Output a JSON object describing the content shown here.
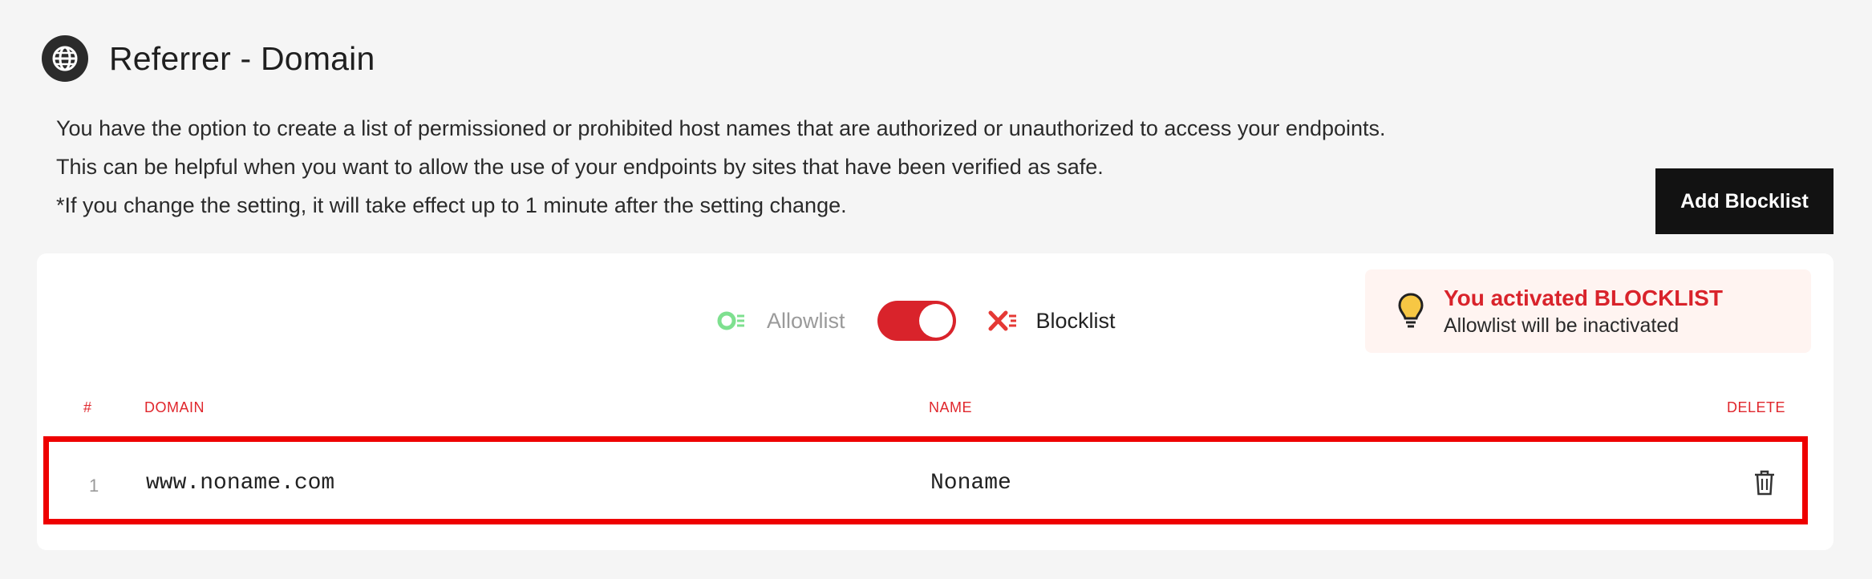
{
  "header": {
    "icon": "globe-icon",
    "title": "Referrer - Domain"
  },
  "description": {
    "line1": "You have the option to create a list of permissioned or prohibited host names that are authorized or unauthorized to access your endpoints.",
    "line2": "This can be helpful when you want to allow the use of your endpoints by sites that have been verified as safe.",
    "line3": "*If you change the setting, it will take effect up to 1 minute after the setting change."
  },
  "actions": {
    "add_label": "Add Blocklist"
  },
  "toggle": {
    "allow_label": "Allowlist",
    "block_label": "Blocklist",
    "allow_icon": "allowlist-icon",
    "block_icon": "blocklist-icon",
    "active": "blocklist"
  },
  "notice": {
    "icon": "lightbulb-icon",
    "title": "You activated BLOCKLIST",
    "subtitle": "Allowlist will be inactivated"
  },
  "table": {
    "columns": {
      "index": "#",
      "domain": "DOMAIN",
      "name": "NAME",
      "delete": "DELETE"
    },
    "rows": [
      {
        "index": "1",
        "domain": "www.noname.com",
        "name": "Noname"
      }
    ]
  },
  "colors": {
    "accent": "#d9232b",
    "allow_green": "#7ee08f",
    "highlight": "#ee0000",
    "button_bg": "#121212"
  }
}
